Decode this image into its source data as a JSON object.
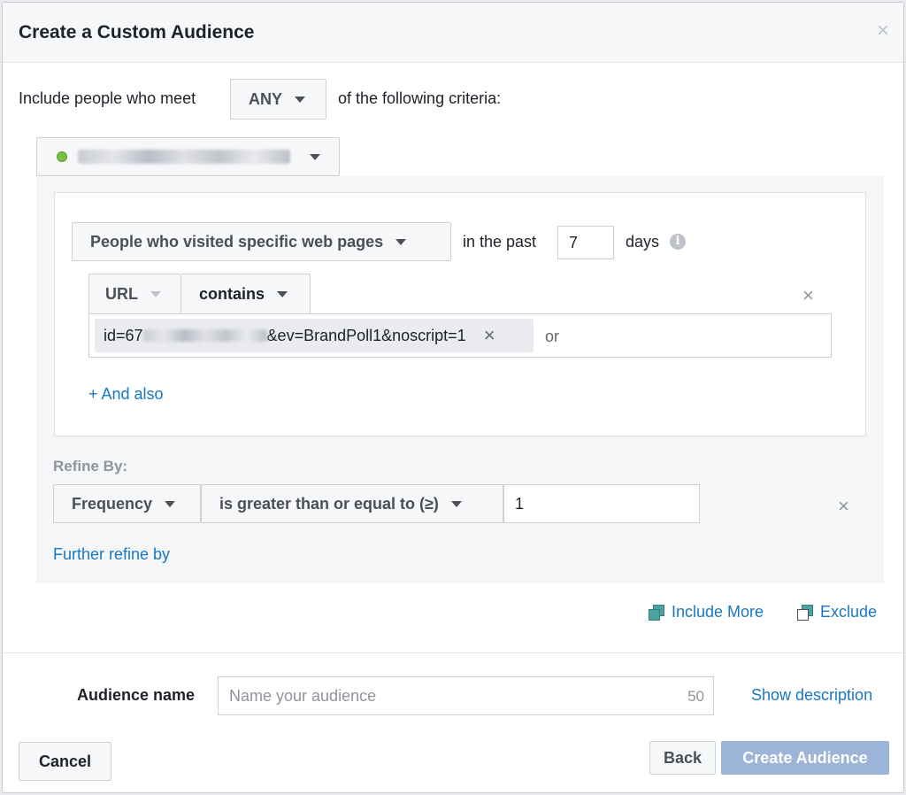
{
  "dialog": {
    "title": "Create a Custom Audience",
    "close_glyph": "×"
  },
  "criteria": {
    "prefix": "Include people who meet",
    "match_value": "ANY",
    "suffix": "of the following criteria:"
  },
  "pixel_source": {
    "status_color": "#7ac143"
  },
  "rule": {
    "type_label": "People who visited specific web pages",
    "in_the_past_label": "in the past",
    "days_value": "7",
    "days_label": "days",
    "info_glyph": "i",
    "url_label": "URL",
    "operator_label": "contains",
    "url_chip_prefix": "id=67",
    "url_chip_suffix": "&ev=BrandPoll1&noscript=1",
    "chip_remove_glyph": "×",
    "or_label": "or",
    "remove_glyph": "×",
    "and_also_label": "+ And also"
  },
  "refine": {
    "heading": "Refine By:",
    "field_label": "Frequency",
    "operator_label": "is greater than or equal to (≥)",
    "value": "1",
    "remove_glyph": "×",
    "further_label": "Further refine by"
  },
  "actions": {
    "include_more_label": "Include More",
    "exclude_label": "Exclude"
  },
  "audience_name": {
    "label": "Audience name",
    "placeholder": "Name your audience",
    "char_count": "50",
    "show_description_label": "Show description"
  },
  "footer": {
    "cancel_label": "Cancel",
    "back_label": "Back",
    "create_label": "Create Audience"
  },
  "colors": {
    "link": "#1877c5",
    "primary_disabled": "#9cb4d8",
    "teal_icon": "#4aa3a2"
  }
}
